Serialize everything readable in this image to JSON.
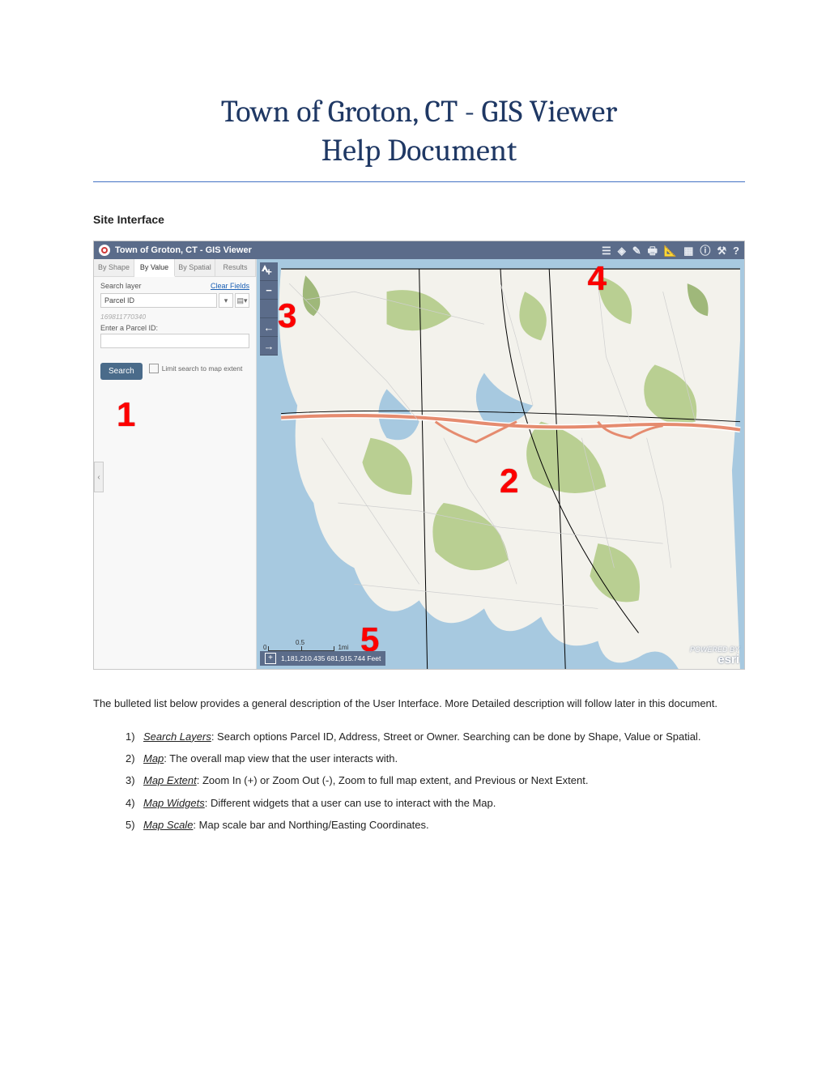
{
  "document": {
    "title_line1": "Town of Groton, CT - GIS Viewer",
    "title_line2": "Help Document",
    "section_heading": "Site Interface",
    "intro_text": "The bulleted list below provides a general description of the User Interface. More Detailed description will follow later in this document.",
    "list": [
      {
        "n": "1)",
        "term": "Search Layers",
        "text": ": Search options Parcel ID, Address, Street or Owner. Searching can be done by Shape, Value or Spatial."
      },
      {
        "n": "2)",
        "term": "Map",
        "text": ":  The overall map view that the user interacts with."
      },
      {
        "n": "3)",
        "term": "Map Extent",
        "text": ": Zoom In (+) or Zoom Out (-), Zoom to full map extent, and Previous or Next Extent."
      },
      {
        "n": "4)",
        "term": "Map Widgets",
        "text": ": Different widgets that a user can use to interact with the Map."
      },
      {
        "n": "5)",
        "term": "Map Scale",
        "text": ": Map scale bar and Northing/Easting Coordinates."
      }
    ]
  },
  "app": {
    "title": "Town of Groton, CT - GIS Viewer",
    "tabs": [
      "By Shape",
      "By Value",
      "By Spatial",
      "Results"
    ],
    "active_tab_index": 1,
    "search_layer_label": "Search layer",
    "clear_fields": "Clear Fields",
    "layer_selected": "Parcel ID",
    "hint": "169811770340",
    "input_label": "Enter a Parcel ID:",
    "search_button": "Search",
    "limit_label": "Limit search to map extent",
    "coord_text": "1,181,210.435 681,915.744 Feet",
    "scale_ticks": [
      "0",
      "0.5",
      "1mi"
    ],
    "esri_small": "POWERED BY",
    "esri_big": "esri",
    "callouts": {
      "c1": "1",
      "c2": "2",
      "c3": "3",
      "c4": "4",
      "c5": "5"
    }
  }
}
